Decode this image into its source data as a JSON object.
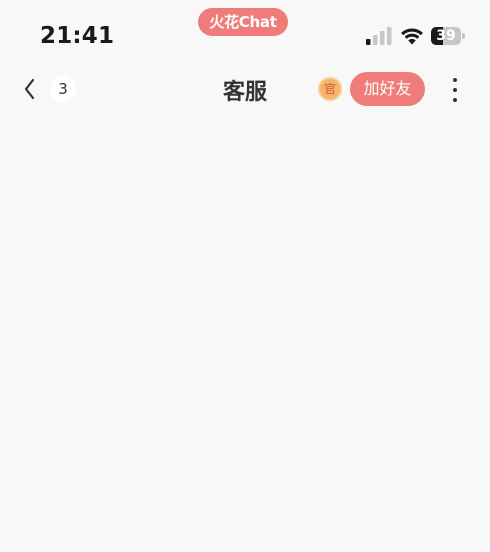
{
  "status_bar": {
    "time": "21:41",
    "app_label": "火花Chat",
    "battery_level": "39",
    "battery_fraction": 0.39,
    "signal_bars_active": 1,
    "signal_bars_total": 4
  },
  "nav": {
    "title": "客服",
    "unread_count": "3",
    "official_badge": "官",
    "add_friend_label": "加好友"
  },
  "colors": {
    "accent": "#ef7c78",
    "badge_orange": "#f3b56e",
    "background": "#f8f8f8"
  },
  "icons": {
    "back": "chevron-left-icon",
    "more": "more-vertical-icon",
    "signal": "cellular-signal-icon",
    "wifi": "wifi-icon"
  }
}
